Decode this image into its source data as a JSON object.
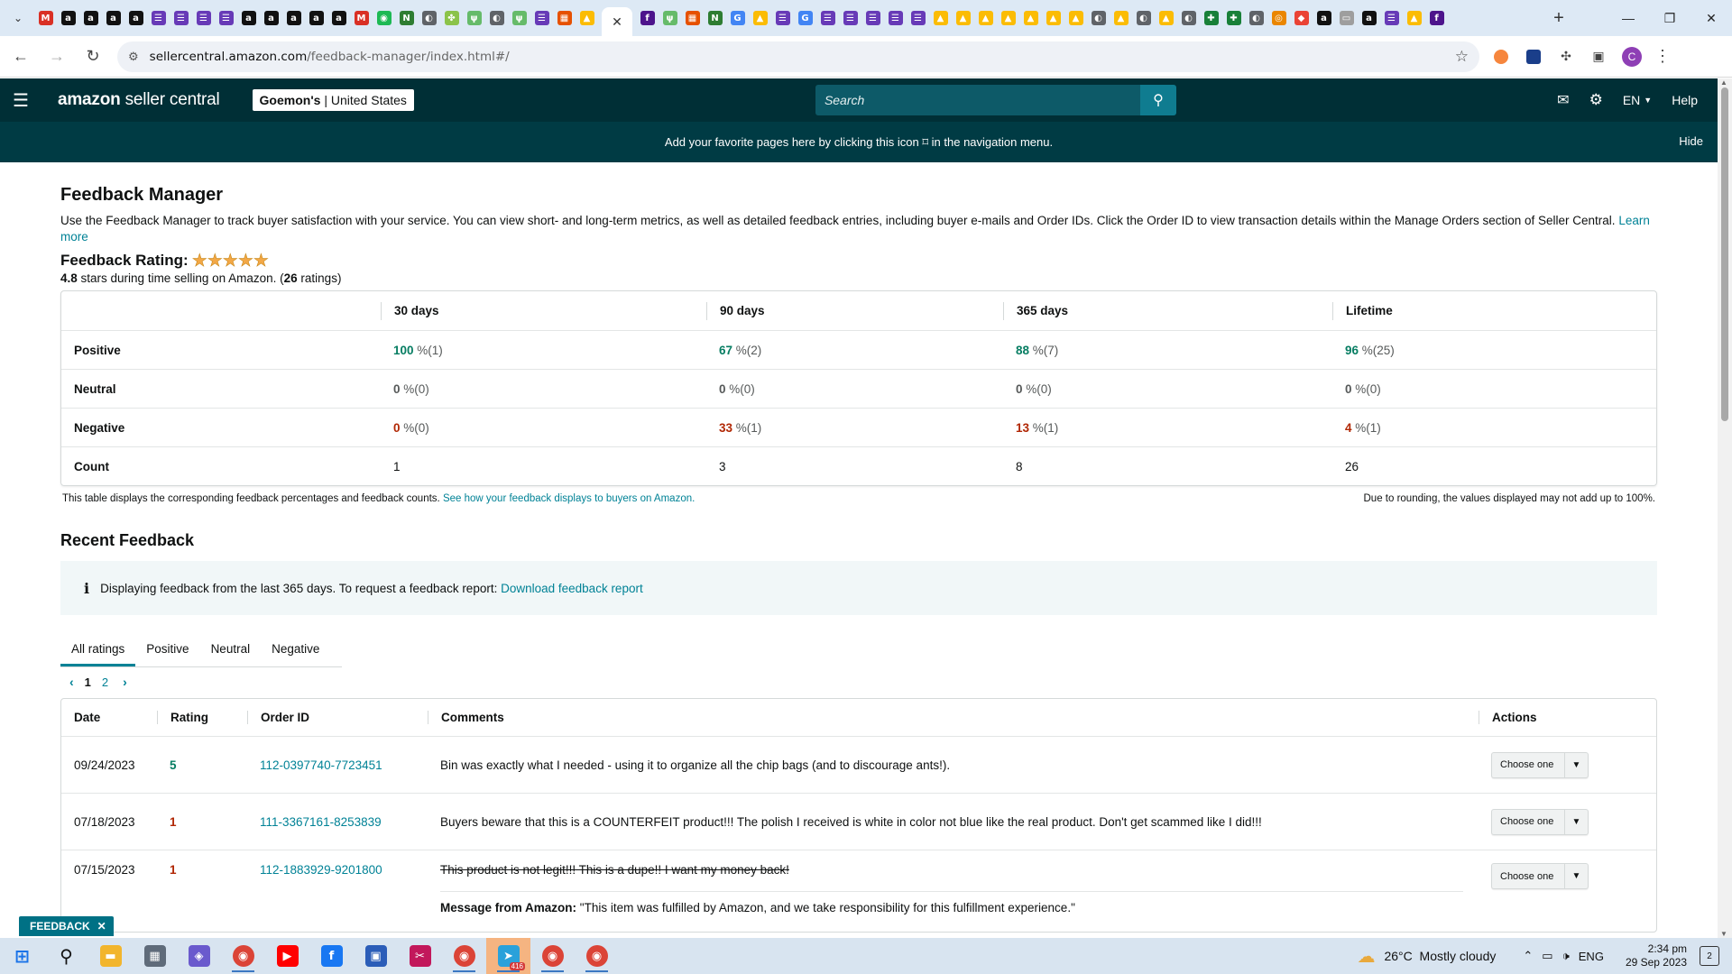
{
  "browser": {
    "tabs": [
      {
        "icon": "gmail-icon",
        "glyph": "M",
        "color": "#d93025"
      },
      {
        "icon": "amazon-icon",
        "glyph": "a",
        "color": "#111111"
      },
      {
        "icon": "amazon-icon",
        "glyph": "a",
        "color": "#111111"
      },
      {
        "icon": "amazon-icon",
        "glyph": "a",
        "color": "#111111"
      },
      {
        "icon": "amazon-icon",
        "glyph": "a",
        "color": "#111111"
      },
      {
        "icon": "forms-icon",
        "glyph": "☰",
        "color": "#673ab7"
      },
      {
        "icon": "forms-icon",
        "glyph": "☰",
        "color": "#673ab7"
      },
      {
        "icon": "forms-icon",
        "glyph": "☰",
        "color": "#673ab7"
      },
      {
        "icon": "forms-icon",
        "glyph": "☰",
        "color": "#673ab7"
      },
      {
        "icon": "amazon-icon",
        "glyph": "a",
        "color": "#111111"
      },
      {
        "icon": "amazon-icon",
        "glyph": "a",
        "color": "#111111"
      },
      {
        "icon": "amazon-icon",
        "glyph": "a",
        "color": "#111111"
      },
      {
        "icon": "amazon-icon",
        "glyph": "a",
        "color": "#111111"
      },
      {
        "icon": "amazon-icon",
        "glyph": "a",
        "color": "#111111"
      },
      {
        "icon": "gmail-icon",
        "glyph": "M",
        "color": "#d93025"
      },
      {
        "icon": "spotify-icon",
        "glyph": "◉",
        "color": "#1db954"
      },
      {
        "icon": "leaf-icon",
        "glyph": "N",
        "color": "#2e7d32"
      },
      {
        "icon": "globe-icon",
        "glyph": "◐",
        "color": "#5f6368"
      },
      {
        "icon": "leaf-icon",
        "glyph": "✤",
        "color": "#8bc34a"
      },
      {
        "icon": "plant-icon",
        "glyph": "ψ",
        "color": "#66bb6a"
      },
      {
        "icon": "globe-icon",
        "glyph": "◐",
        "color": "#5f6368"
      },
      {
        "icon": "plant-icon",
        "glyph": "ψ",
        "color": "#66bb6a"
      },
      {
        "icon": "forms-icon",
        "glyph": "☰",
        "color": "#673ab7"
      },
      {
        "icon": "windows-tiles-icon",
        "glyph": "▦",
        "color": "#e65100"
      },
      {
        "icon": "drive-icon",
        "glyph": "▲",
        "color": "#fbbc04"
      }
    ],
    "active_tab_close": "✕",
    "tabs_after": [
      {
        "icon": "fedex-icon",
        "glyph": "f",
        "color": "#4d148c"
      },
      {
        "icon": "plant-icon",
        "glyph": "ψ",
        "color": "#66bb6a"
      },
      {
        "icon": "windows-tiles-icon",
        "glyph": "▦",
        "color": "#e65100"
      },
      {
        "icon": "leaf-icon",
        "glyph": "N",
        "color": "#2e7d32"
      },
      {
        "icon": "google-icon",
        "glyph": "G",
        "color": "#4285f4"
      },
      {
        "icon": "drive-icon",
        "glyph": "▲",
        "color": "#fbbc04"
      },
      {
        "icon": "forms-icon",
        "glyph": "☰",
        "color": "#673ab7"
      },
      {
        "icon": "google-icon",
        "glyph": "G",
        "color": "#4285f4"
      },
      {
        "icon": "forms-icon",
        "glyph": "☰",
        "color": "#673ab7"
      },
      {
        "icon": "forms-icon",
        "glyph": "☰",
        "color": "#673ab7"
      },
      {
        "icon": "forms-icon",
        "glyph": "☰",
        "color": "#673ab7"
      },
      {
        "icon": "forms-icon",
        "glyph": "☰",
        "color": "#673ab7"
      },
      {
        "icon": "forms-icon",
        "glyph": "☰",
        "color": "#673ab7"
      },
      {
        "icon": "drive-icon",
        "glyph": "▲",
        "color": "#fbbc04"
      },
      {
        "icon": "drive-icon",
        "glyph": "▲",
        "color": "#fbbc04"
      },
      {
        "icon": "drive-icon",
        "glyph": "▲",
        "color": "#fbbc04"
      },
      {
        "icon": "drive-icon",
        "glyph": "▲",
        "color": "#fbbc04"
      },
      {
        "icon": "drive-icon",
        "glyph": "▲",
        "color": "#fbbc04"
      },
      {
        "icon": "drive-icon",
        "glyph": "▲",
        "color": "#fbbc04"
      },
      {
        "icon": "drive-icon",
        "glyph": "▲",
        "color": "#fbbc04"
      },
      {
        "icon": "globe-icon",
        "glyph": "◐",
        "color": "#5f6368"
      },
      {
        "icon": "drive-icon",
        "glyph": "▲",
        "color": "#fbbc04"
      },
      {
        "icon": "globe-icon",
        "glyph": "◐",
        "color": "#5f6368"
      },
      {
        "icon": "drive-icon",
        "glyph": "▲",
        "color": "#fbbc04"
      },
      {
        "icon": "globe-icon",
        "glyph": "◐",
        "color": "#5f6368"
      },
      {
        "icon": "sheets-icon",
        "glyph": "✚",
        "color": "#188038"
      },
      {
        "icon": "sheets-icon",
        "glyph": "✚",
        "color": "#188038"
      },
      {
        "icon": "globe-icon",
        "glyph": "◐",
        "color": "#5f6368"
      },
      {
        "icon": "google-icon",
        "glyph": "◎",
        "color": "#ea8600"
      },
      {
        "icon": "maps-icon",
        "glyph": "◆",
        "color": "#ea4335"
      },
      {
        "icon": "amazon-icon",
        "glyph": "a",
        "color": "#111111"
      },
      {
        "icon": "image-icon",
        "glyph": "▭",
        "color": "#9e9e9e"
      },
      {
        "icon": "amazon-icon",
        "glyph": "a",
        "color": "#111111"
      },
      {
        "icon": "forms-icon",
        "glyph": "☰",
        "color": "#673ab7"
      },
      {
        "icon": "drive-icon",
        "glyph": "▲",
        "color": "#fbbc04"
      },
      {
        "icon": "fedex-icon",
        "glyph": "f",
        "color": "#4d148c"
      }
    ],
    "url_host": "sellercentral.amazon.com",
    "url_path": "/feedback-manager/index.html#/",
    "profile_initial": "C"
  },
  "header": {
    "logo_bold": "amazon",
    "logo_rest": " seller central",
    "store_name": "Goemon's",
    "store_sep": " | ",
    "store_region": "United States",
    "search_placeholder": "Search",
    "language": "EN",
    "help": "Help"
  },
  "banner": {
    "text_before": "Add your favorite pages here by clicking this icon",
    "text_after": "in the navigation menu.",
    "hide": "Hide"
  },
  "page": {
    "title": "Feedback Manager",
    "description": "Use the Feedback Manager to track buyer satisfaction with your service. You can view short- and long-term metrics, as well as detailed feedback entries, including buyer e-mails and Order IDs. Click the Order ID to view transaction details within the Manage Orders section of Seller Central.",
    "learn_more": "Learn more",
    "rating_label": "Feedback Rating:",
    "stars": 5,
    "rating_value": "4.8",
    "summary_mid": " stars during time selling on Amazon. (",
    "rating_count": "26",
    "summary_end": " ratings)"
  },
  "metrics": {
    "columns": [
      "30 days",
      "90 days",
      "365 days",
      "Lifetime"
    ],
    "rows": [
      {
        "label": "Positive",
        "cells": [
          {
            "pct": "100",
            "rest": " %(1)",
            "tone": "g"
          },
          {
            "pct": "67",
            "rest": " %(2)",
            "tone": "g"
          },
          {
            "pct": "88",
            "rest": " %(7)",
            "tone": "g"
          },
          {
            "pct": "96",
            "rest": " %(25)",
            "tone": "g"
          }
        ]
      },
      {
        "label": "Neutral",
        "cells": [
          {
            "pct": "0",
            "rest": " %(0)",
            "tone": "k"
          },
          {
            "pct": "0",
            "rest": " %(0)",
            "tone": "k"
          },
          {
            "pct": "0",
            "rest": " %(0)",
            "tone": "k"
          },
          {
            "pct": "0",
            "rest": " %(0)",
            "tone": "k"
          }
        ]
      },
      {
        "label": "Negative",
        "cells": [
          {
            "pct": "0",
            "rest": " %(0)",
            "tone": "r"
          },
          {
            "pct": "33",
            "rest": " %(1)",
            "tone": "r"
          },
          {
            "pct": "13",
            "rest": " %(1)",
            "tone": "r"
          },
          {
            "pct": "4",
            "rest": " %(1)",
            "tone": "r"
          }
        ]
      }
    ],
    "count_label": "Count",
    "counts": [
      "1",
      "3",
      "8",
      "26"
    ],
    "note": "This table displays the corresponding feedback percentages and feedback counts.",
    "note_link": "See how your feedback displays to buyers on Amazon.",
    "rounding_note": "Due to rounding, the values displayed may not add up to 100%."
  },
  "recent": {
    "title": "Recent Feedback",
    "info_text": "Displaying feedback from the last 365 days. To request a feedback report:",
    "info_link": "Download feedback report",
    "tabs": [
      "All ratings",
      "Positive",
      "Neutral",
      "Negative"
    ],
    "pages": [
      "1",
      "2"
    ],
    "columns": {
      "date": "Date",
      "rating": "Rating",
      "order": "Order ID",
      "comments": "Comments",
      "actions": "Actions"
    },
    "action_label": "Choose one",
    "rows": [
      {
        "date": "09/24/2023",
        "rating": "5",
        "tone": "g",
        "order": "112-0397740-7723451",
        "comment": "Bin was exactly what I needed - using it to organize all the chip bags (and to discourage ants!)."
      },
      {
        "date": "07/18/2023",
        "rating": "1",
        "tone": "r",
        "order": "111-3367161-8253839",
        "comment": "Buyers beware that this is a COUNTERFEIT product!!! The polish I received is white in color not blue like the real product. Don't get scammed like I did!!!"
      },
      {
        "date": "07/15/2023",
        "rating": "1",
        "tone": "r",
        "order": "112-1883929-9201800",
        "comment": "This product is not legit!!! This is a dupe!! I want my money back!",
        "struck": true,
        "amazon_msg_label": "Message from Amazon:",
        "amazon_msg": " \"This item was fulfilled by Amazon, and we take responsibility for this fulfillment experience.\""
      }
    ]
  },
  "feedback_tag": "FEEDBACK",
  "taskbar": {
    "apps": [
      {
        "name": "windows-start-icon",
        "glyph": "⊞",
        "color": "#1a73e8",
        "open": false
      },
      {
        "name": "search-icon",
        "glyph": "⚲",
        "color": "#111111",
        "open": false
      },
      {
        "name": "file-explorer-icon",
        "glyph": "▬",
        "color": "#f2b52d",
        "open": false
      },
      {
        "name": "calculator-icon",
        "glyph": "▦",
        "color": "#5f6b7a",
        "open": false
      },
      {
        "name": "copilot-icon",
        "glyph": "◈",
        "color": "#6a5acd",
        "open": false
      },
      {
        "name": "chrome-icon",
        "glyph": "◉",
        "color": "#db4437",
        "open": true
      },
      {
        "name": "youtube-icon",
        "glyph": "▶",
        "color": "#ff0000",
        "open": false
      },
      {
        "name": "facebook-icon",
        "glyph": "f",
        "color": "#1877f2",
        "open": false
      },
      {
        "name": "store-icon",
        "glyph": "▣",
        "color": "#2b5db8",
        "open": false
      },
      {
        "name": "snipping-tool-icon",
        "glyph": "✂",
        "color": "#c2185b",
        "open": false
      },
      {
        "name": "chrome-icon",
        "glyph": "◉",
        "color": "#db4437",
        "open": true
      },
      {
        "name": "telegram-icon",
        "glyph": "➤",
        "color": "#2aa1da",
        "open": true,
        "highlight": true,
        "badge": "416"
      },
      {
        "name": "chrome-icon",
        "glyph": "◉",
        "color": "#db4437",
        "open": true
      },
      {
        "name": "chrome-icon",
        "glyph": "◉",
        "color": "#db4437",
        "open": true
      }
    ],
    "temperature": "26°C",
    "weather": "Mostly cloudy",
    "lang": "ENG",
    "time": "2:34 pm",
    "date": "29 Sep 2023",
    "notifications": "2"
  },
  "colors": {
    "header_bg": "#002f36",
    "banner_bg": "#003b44",
    "link": "#008296",
    "positive": "#067d62",
    "negative": "#b12704",
    "star": "#f3a847"
  }
}
